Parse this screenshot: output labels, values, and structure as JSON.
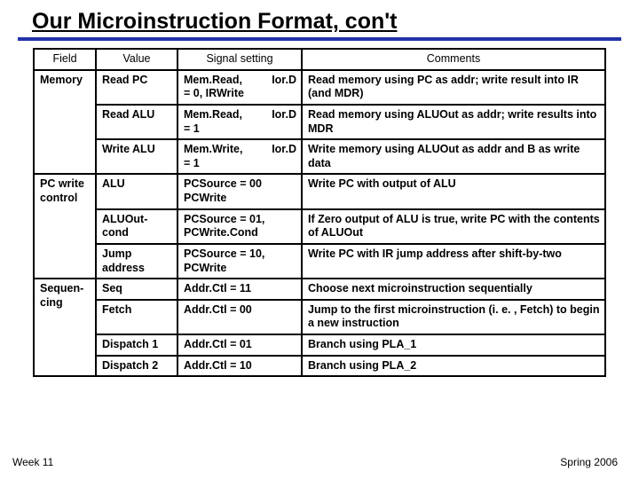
{
  "title": "Our Microinstruction Format, con't",
  "headers": {
    "field": "Field",
    "value": "Value",
    "signal": "Signal setting",
    "comments": "Comments"
  },
  "groups": [
    {
      "field": "Memory",
      "rows": [
        {
          "value": "Read PC",
          "signal_left": "Mem.Read,",
          "signal_right": "Ior.D",
          "signal_line2": "= 0, IRWrite",
          "comments": "Read memory using PC as addr; write result into IR (and MDR)"
        },
        {
          "value": "Read ALU",
          "signal_left": "Mem.Read,",
          "signal_right": "Ior.D",
          "signal_line2": "= 1",
          "comments": "Read memory using ALUOut as addr; write results into MDR"
        },
        {
          "value": "Write ALU",
          "signal_left": "Mem.Write,",
          "signal_right": "Ior.D",
          "signal_line2": "= 1",
          "comments": "Write memory using ALUOut as addr and B as write data"
        }
      ]
    },
    {
      "field": "PC write control",
      "rows": [
        {
          "value": "ALU",
          "signal_left": "PCSource = 00 PCWrite",
          "signal_right": "",
          "signal_line2": "",
          "comments": "Write PC with output of ALU"
        },
        {
          "value": "ALUOut-cond",
          "signal_left": "PCSource = 01, PCWrite.Cond",
          "signal_right": "",
          "signal_line2": "",
          "comments": "If Zero output of ALU is true, write PC with the contents of ALUOut"
        },
        {
          "value": "Jump address",
          "signal_left": "PCSource = 10, PCWrite",
          "signal_right": "",
          "signal_line2": "",
          "comments": "Write PC with IR jump address after shift-by-two"
        }
      ]
    },
    {
      "field": "Sequen-cing",
      "rows": [
        {
          "value": "Seq",
          "signal_left": "Addr.Ctl = 11",
          "signal_right": "",
          "signal_line2": "",
          "comments": "Choose next microinstruction sequentially"
        },
        {
          "value": "Fetch",
          "signal_left": "Addr.Ctl = 00",
          "signal_right": "",
          "signal_line2": "",
          "comments": "Jump to the first microinstruction (i. e. , Fetch) to begin a new instruction"
        },
        {
          "value": "Dispatch 1",
          "signal_left": "Addr.Ctl = 01",
          "signal_right": "",
          "signal_line2": "",
          "comments": "Branch using PLA_1"
        },
        {
          "value": "Dispatch 2",
          "signal_left": "Addr.Ctl = 10",
          "signal_right": "",
          "signal_line2": "",
          "comments": "Branch using PLA_2"
        }
      ]
    }
  ],
  "footer": {
    "left": "Week 11",
    "right": "Spring 2006"
  }
}
